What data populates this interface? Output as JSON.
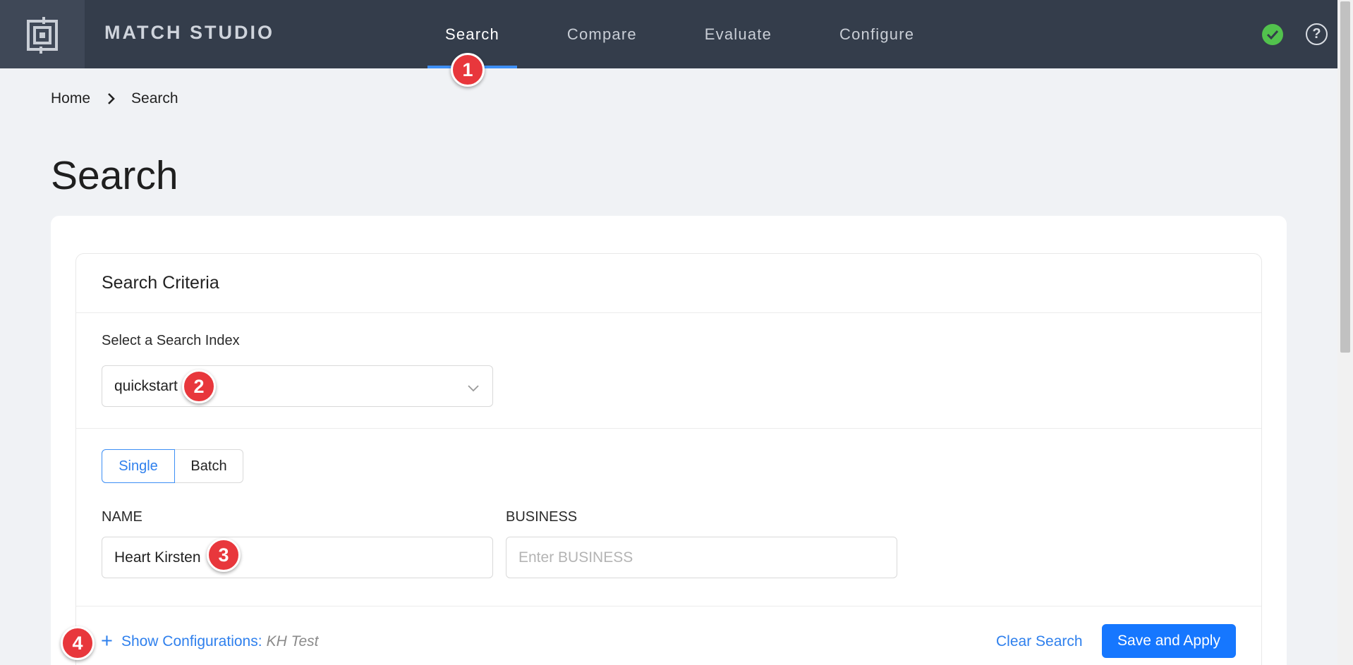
{
  "header": {
    "brand": "MATCH STUDIO",
    "nav": [
      {
        "label": "Search",
        "active": true
      },
      {
        "label": "Compare",
        "active": false
      },
      {
        "label": "Evaluate",
        "active": false
      },
      {
        "label": "Configure",
        "active": false
      }
    ],
    "status_icon": "check-circle-icon",
    "help_icon": "question-circle-icon",
    "help_glyph": "?"
  },
  "breadcrumb": {
    "home": "Home",
    "current": "Search"
  },
  "page": {
    "title": "Search"
  },
  "criteria": {
    "title": "Search Criteria",
    "index_label": "Select a Search Index",
    "index_value": "quickstart",
    "modes": {
      "single": "Single",
      "batch": "Batch",
      "selected": "Single"
    },
    "fields": {
      "name": {
        "label": "NAME",
        "value": "Heart Kirsten",
        "placeholder": ""
      },
      "business": {
        "label": "BUSINESS",
        "value": "",
        "placeholder": "Enter BUSINESS"
      }
    }
  },
  "footer": {
    "show_config_label": "Show Configurations:",
    "config_name": "KH Test",
    "plus": "+",
    "clear_label": "Clear Search",
    "save_label": "Save and Apply"
  },
  "markers": [
    "1",
    "2",
    "3",
    "4"
  ],
  "colors": {
    "topbar": "#343d4b",
    "accent": "#1677ff",
    "marker": "#e8373c",
    "status": "#52c24d"
  }
}
